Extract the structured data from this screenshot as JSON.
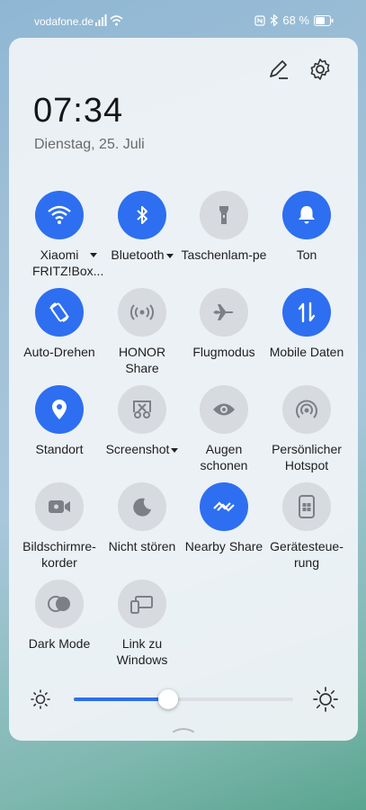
{
  "status": {
    "carrier": "vodafone.de",
    "battery": "68 %"
  },
  "header": {
    "time": "07:34",
    "date": "Dienstag, 25. Juli"
  },
  "tiles": [
    {
      "label": "Xiaomi FRITZ!Box...",
      "icon": "wifi-icon",
      "active": true
    },
    {
      "label": "Bluetooth",
      "icon": "bluetooth-icon",
      "active": true
    },
    {
      "label": "Taschenlam-pe",
      "icon": "flashlight-icon",
      "active": false
    },
    {
      "label": "Ton",
      "icon": "bell-icon",
      "active": true
    },
    {
      "label": "Auto-Drehen",
      "icon": "auto-rotate-icon",
      "active": true
    },
    {
      "label": "HONOR Share",
      "icon": "honor-share-icon",
      "active": false
    },
    {
      "label": "Flugmodus",
      "icon": "airplane-icon",
      "active": false
    },
    {
      "label": "Mobile Daten",
      "icon": "mobile-data-icon",
      "active": true
    },
    {
      "label": "Standort",
      "icon": "location-icon",
      "active": true
    },
    {
      "label": "Screenshot",
      "icon": "screenshot-icon",
      "active": false
    },
    {
      "label": "Augen schonen",
      "icon": "eye-icon",
      "active": false
    },
    {
      "label": "Persönlicher Hotspot",
      "icon": "hotspot-icon",
      "active": false
    },
    {
      "label": "Bildschirmre-korder",
      "icon": "screen-recorder-icon",
      "active": false
    },
    {
      "label": "Nicht stören",
      "icon": "moon-icon",
      "active": false
    },
    {
      "label": "Nearby Share",
      "icon": "nearby-share-icon",
      "active": true
    },
    {
      "label": "Gerätesteue-rung",
      "icon": "device-control-icon",
      "active": false
    },
    {
      "label": "Dark Mode",
      "icon": "dark-mode-icon",
      "active": false
    },
    {
      "label": "Link zu Windows",
      "icon": "link-windows-icon",
      "active": false
    }
  ],
  "brightness": {
    "level_percent": 43
  },
  "colors": {
    "accent": "#2d6ff0",
    "tile_off": "#d7dadf"
  }
}
